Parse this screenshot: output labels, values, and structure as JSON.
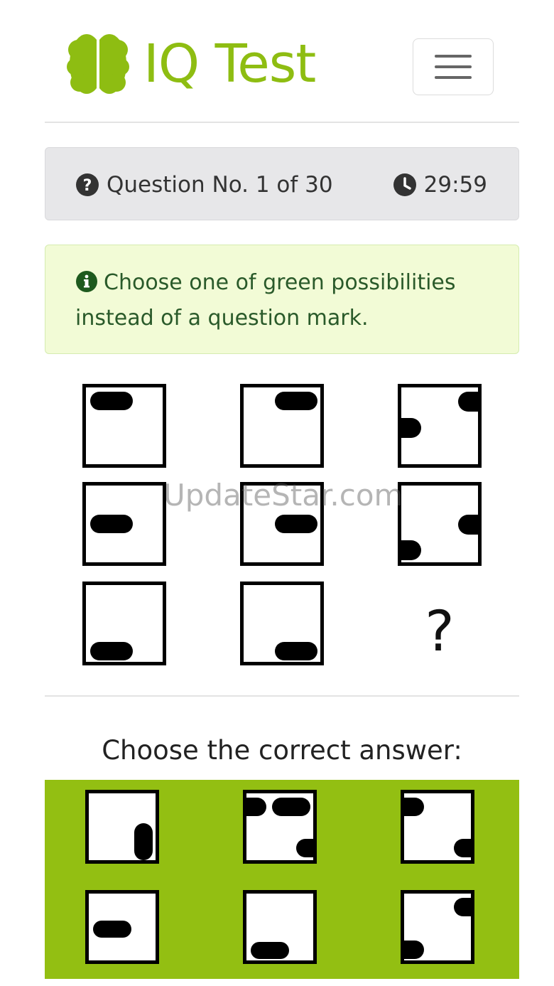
{
  "header": {
    "brand_name": "IQ Test",
    "menu_icon": "hamburger-icon"
  },
  "question_bar": {
    "question_label": "Question No. 1 of 30",
    "timer": "29:59",
    "question_icon": "question-circle-icon",
    "timer_icon": "clock-icon"
  },
  "info": {
    "text": "Choose one of green possibilities instead of a question mark.",
    "icon": "info-circle-icon"
  },
  "puzzle": {
    "missing_symbol": "?"
  },
  "watermark": "UpdateStar.com",
  "answers": {
    "title": "Choose the correct answer:",
    "count": 6
  },
  "colors": {
    "brand_green": "#8ebd12",
    "answer_bg": "#93bf12",
    "info_bg": "#f2fbd6",
    "info_text": "#2a5a2a",
    "question_bar_bg": "#e7e7e9"
  }
}
